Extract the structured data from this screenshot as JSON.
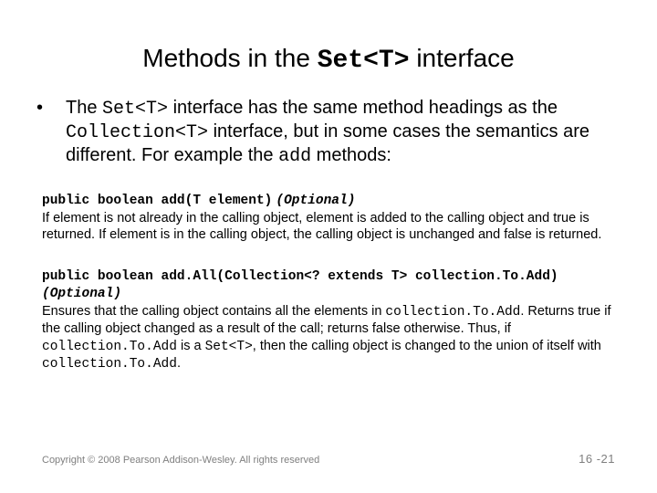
{
  "title": {
    "pre": "Methods in the ",
    "code": "Set<T>",
    "post": " interface"
  },
  "bullet": {
    "dot": "•",
    "t1": "The ",
    "c1": "Set<T>",
    "t2": " interface has the same method headings as the ",
    "c2": "Collection<T>",
    "t3": " interface, but in some cases the semantics are different.  For example the ",
    "c3": "add",
    "t4": " methods:"
  },
  "m1": {
    "sig": "public boolean add(T element)",
    "opt": "(Optional)",
    "desc": "If element is not already in the calling object, element is added to the calling object and true is returned. If element is in the calling object, the calling object is unchanged and false is returned."
  },
  "m2": {
    "sig": "public boolean add.All(Collection<? extends T> collection.To.Add)",
    "opt": "(Optional)",
    "d1": "Ensures that the calling object contains all the elements in ",
    "c1": "collection.To.Add",
    "d2": ". Returns true if the calling object changed as a result of the call; returns false otherwise. Thus, if ",
    "c2": "collection.To.Add",
    "d3": " is a ",
    "c3": "Set<T>",
    "d4": ", then the calling object is changed to the union of itself with ",
    "c4": "collection.To.Add",
    "d5": "."
  },
  "footer": {
    "copyright": "Copyright © 2008 Pearson Addison-Wesley. All rights reserved",
    "pagenum": "16 -21"
  }
}
